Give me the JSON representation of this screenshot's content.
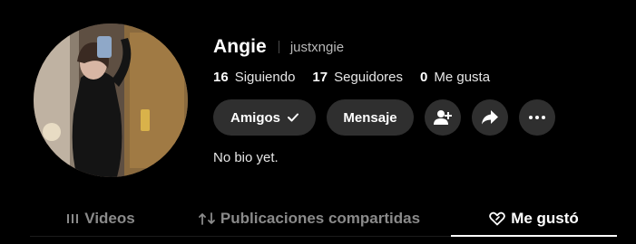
{
  "profile": {
    "display_name": "Angie",
    "username": "justxngie",
    "avatar_icon": "profile-photo",
    "bio": "No bio yet."
  },
  "stats": [
    {
      "value": "16",
      "label": "Siguiendo"
    },
    {
      "value": "17",
      "label": "Seguidores"
    },
    {
      "value": "0",
      "label": "Me gusta"
    }
  ],
  "actions": {
    "friends_label": "Amigos",
    "friends_icon": "check-icon",
    "message_label": "Mensaje",
    "add_friend_icon": "add-person-icon",
    "share_icon": "share-arrow-icon",
    "more_icon": "more-dots-icon"
  },
  "tabs": [
    {
      "label": "Videos",
      "icon": "grid-lines-icon",
      "active": false
    },
    {
      "label": "Publicaciones compartidas",
      "icon": "repost-icon",
      "active": false
    },
    {
      "label": "Me gustó",
      "icon": "heart-icon",
      "active": true
    }
  ],
  "colors": {
    "background": "#000000",
    "button_bg": "#2f2f2f",
    "muted_text": "#8a8a8a",
    "active_text": "#ffffff"
  }
}
